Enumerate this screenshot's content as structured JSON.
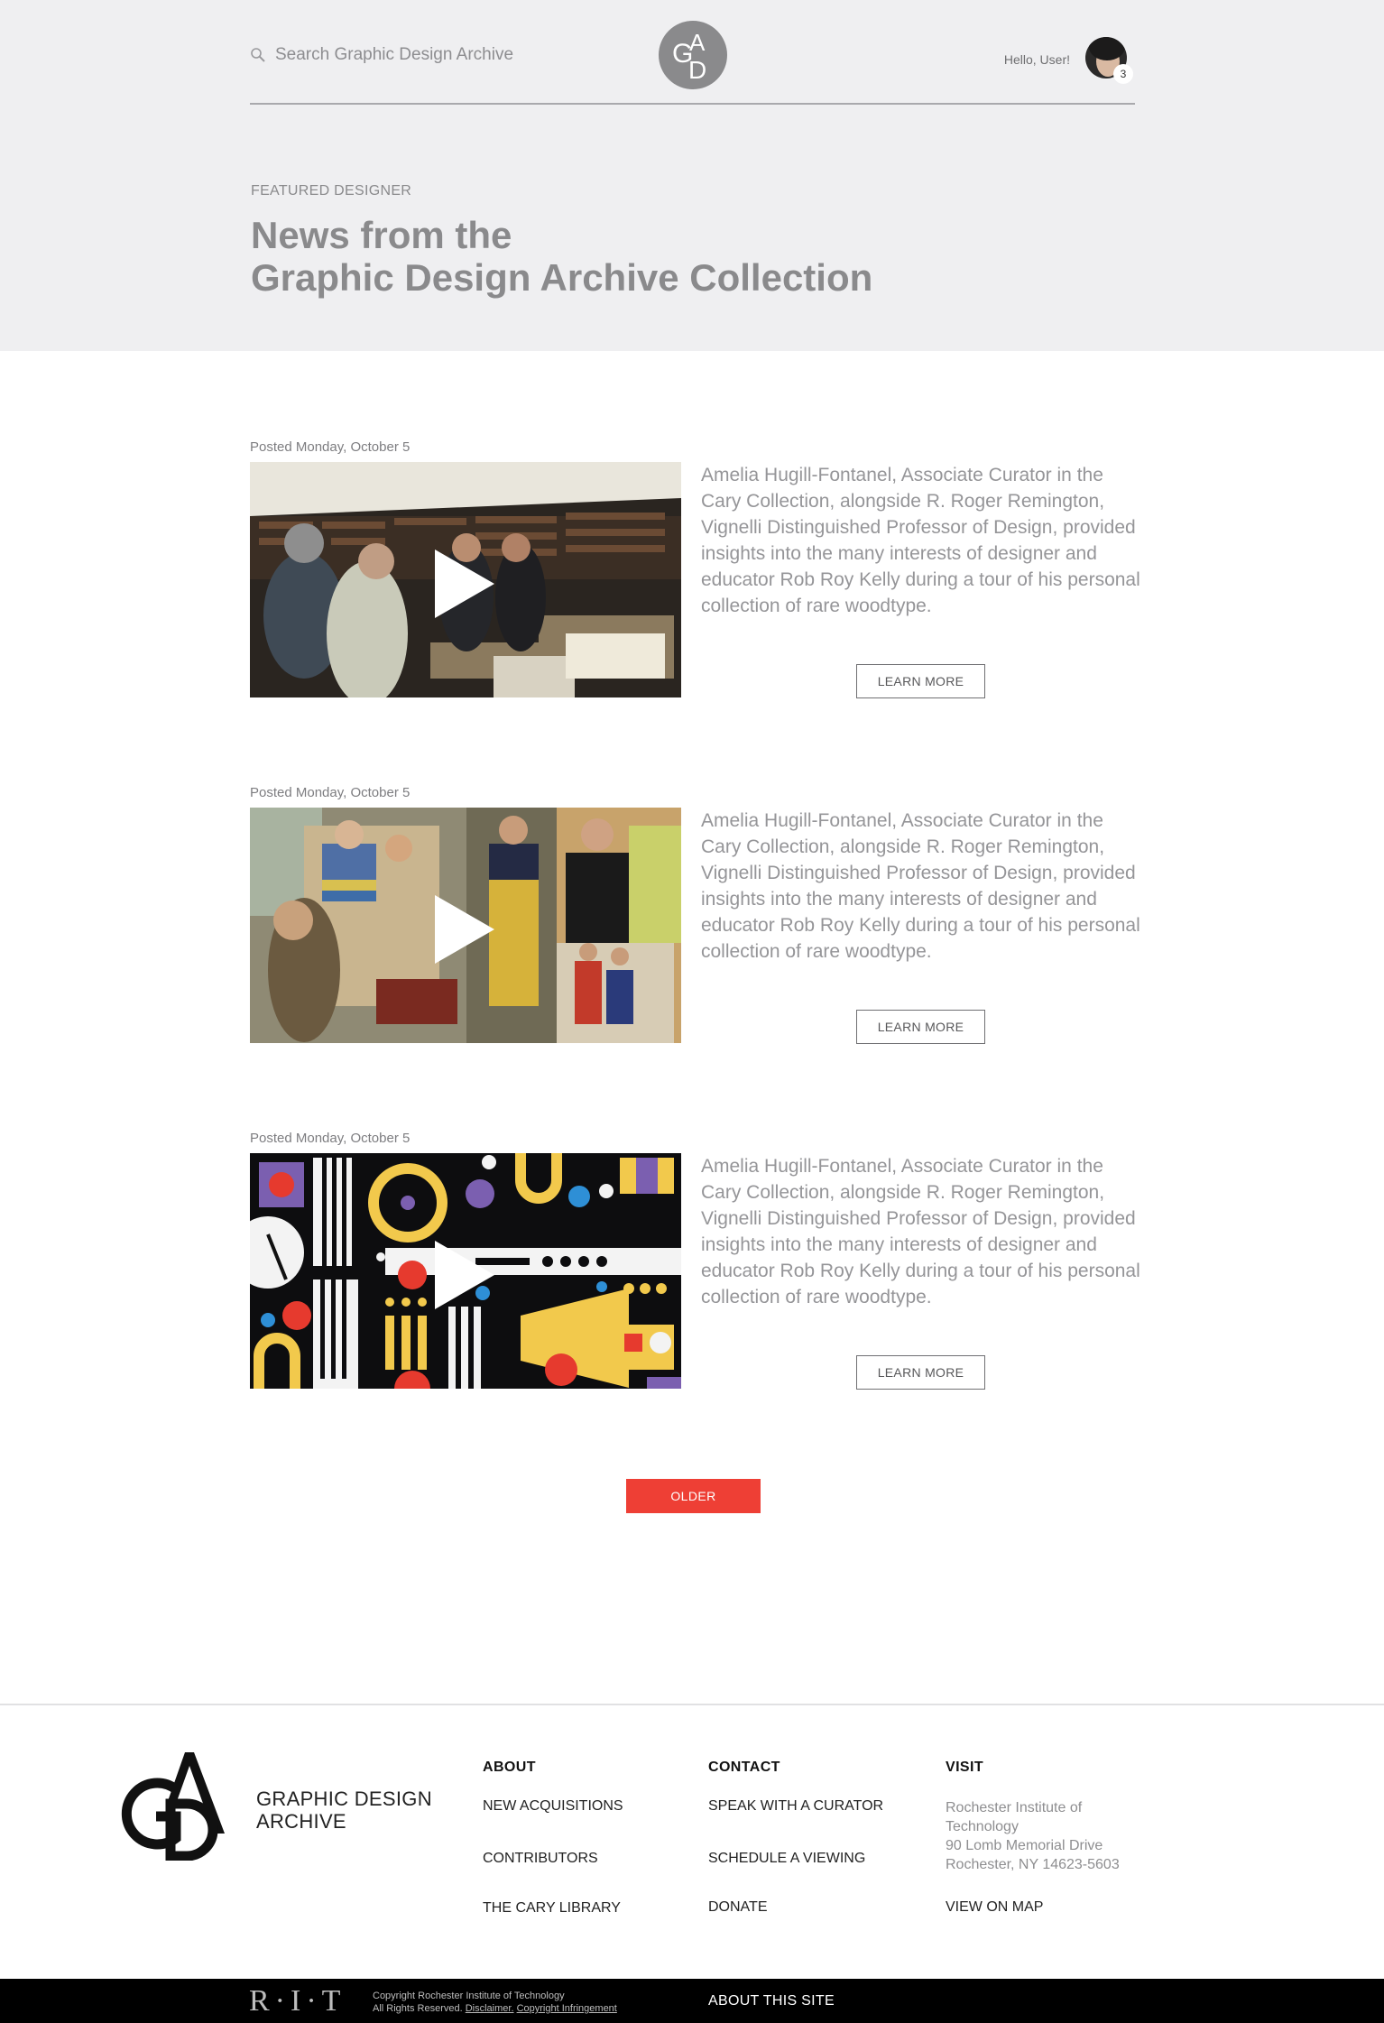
{
  "header": {
    "search_placeholder": "Search Graphic Design Archive",
    "greeting": "Hello, User!",
    "notification_count": "3",
    "logo_letters": "GAD"
  },
  "hero": {
    "eyebrow": "FEATURED DESIGNER",
    "title_line1": "News from the",
    "title_line2": "Graphic Design Archive Collection"
  },
  "posts": [
    {
      "date": "Posted Monday, October 5",
      "body": "Amelia Hugill-Fontanel, Associate Curator in the Cary Collection, alongside R. Roger Remington, Vignelli Distinguished Professor of Design, provided insights into the many interests of designer and educator Rob Roy Kelly during a tour of his personal collection of rare woodtype.",
      "button": "LEARN MORE"
    },
    {
      "date": "Posted Monday, October 5",
      "body": "Amelia Hugill-Fontanel, Associate Curator in the Cary Collection, alongside R. Roger Remington, Vignelli Distinguished Professor of Design, provided insights into the many interests of designer and educator Rob Roy Kelly during a tour of his personal collection of rare woodtype.",
      "button": "LEARN MORE"
    },
    {
      "date": "Posted Monday, October 5",
      "body": "Amelia Hugill-Fontanel, Associate Curator in the Cary Collection, alongside R. Roger Remington, Vignelli Distinguished Professor of Design, provided insights into the many interests of designer and educator Rob Roy Kelly during a tour of his personal collection of rare woodtype.",
      "button": "LEARN MORE"
    }
  ],
  "older_button": "OLDER",
  "footer": {
    "brand_line1": "GRAPHIC DESIGN",
    "brand_line2": "ARCHIVE",
    "about": {
      "heading": "ABOUT",
      "links": [
        "NEW ACQUISITIONS",
        "CONTRIBUTORS",
        "THE CARY LIBRARY"
      ]
    },
    "contact": {
      "heading": "CONTACT",
      "links": [
        "SPEAK WITH A CURATOR",
        "SCHEDULE A VIEWING",
        "DONATE"
      ]
    },
    "visit": {
      "heading": "VISIT",
      "address": [
        "Rochester Institute of",
        "Technology",
        "90 Lomb Memorial Drive",
        "Rochester, NY 14623-5603"
      ],
      "map_link": "VIEW ON MAP"
    }
  },
  "bottom_bar": {
    "rit_logo": "R·I·T",
    "copyright_line1": "Copyright Rochester Institute of Technology",
    "copyright_prefix": "All Rights Reserved.",
    "disclaimer": "Disclaimer.",
    "infringement": "Copyright Infringement",
    "about_site": "ABOUT THIS SITE"
  },
  "colors": {
    "hero_bg": "#efeff1",
    "accent_red": "#ee3f35",
    "bottom_bar": "#000000"
  }
}
